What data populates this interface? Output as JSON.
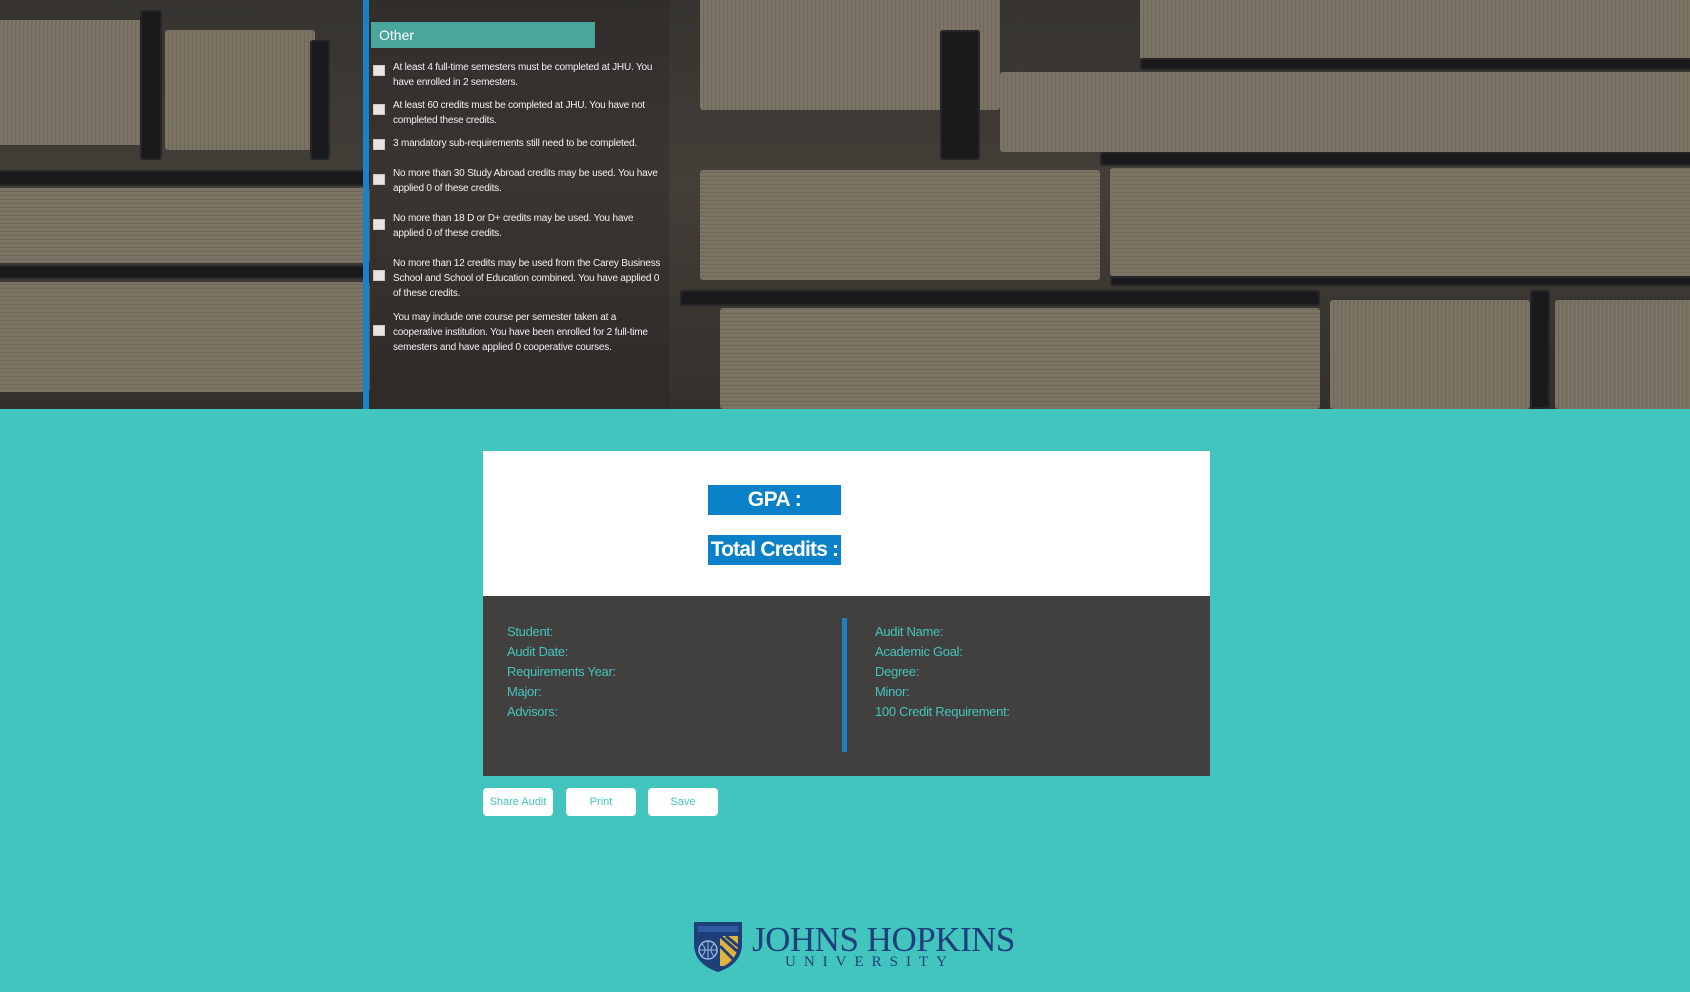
{
  "other_section": {
    "header": "Other",
    "requirements": [
      {
        "text": "At least 4 full-time semesters must be completed at JHU. You have enrolled in 2 semesters."
      },
      {
        "text": "At least 60 credits must be completed at JHU. You have not completed these credits."
      },
      {
        "text": "3 mandatory sub-requirements still need to be completed."
      },
      {
        "text": "No more than 30 Study Abroad credits may be used. You have applied 0 of these credits."
      },
      {
        "text": "No more than 18 D or D+ credits may be used. You have applied 0 of these credits."
      },
      {
        "text": "No more than 12 credits may be used from the Carey Business School and School of Education combined. You have applied 0 of these credits."
      },
      {
        "text": "You may include one course per semester taken at a cooperative institution. You have been enrolled for 2 full-time semesters and have applied 0 cooperative courses."
      }
    ]
  },
  "summary": {
    "gpa_label": "GPA :",
    "total_credits_label": "Total Credits :"
  },
  "audit_info": {
    "left": [
      "Student:",
      "Audit Date:",
      "Requirements Year:",
      "Major:",
      "Advisors:"
    ],
    "right": [
      "Audit Name:",
      "Academic Goal:",
      "Degree:",
      "Minor:",
      "100 Credit Requirement:"
    ]
  },
  "actions": {
    "share_label": "Share Audit",
    "print_label": "Print",
    "save_label": "Save"
  },
  "logo": {
    "wordmark": "JOHNS HOPKINS",
    "sub": "UNIVERSITY"
  },
  "colors": {
    "page_background": "#42c5bf",
    "accent_blue": "#0a80c8",
    "header_teal": "#4aa59c",
    "info_panel": "#423f3f",
    "brand_navy": "#1f3f7a"
  }
}
